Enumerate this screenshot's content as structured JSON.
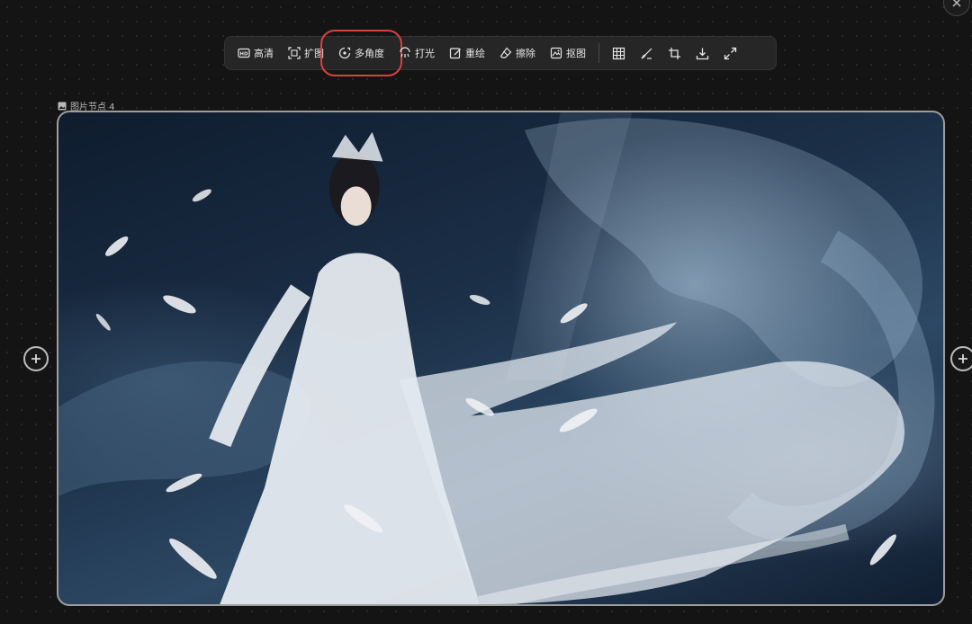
{
  "toolbar": {
    "buttons": [
      {
        "label": "高清",
        "icon": "hd-icon"
      },
      {
        "label": "扩图",
        "icon": "expand-image-icon"
      },
      {
        "label": "多角度",
        "icon": "multi-angle-icon",
        "highlighted": true
      },
      {
        "label": "打光",
        "icon": "lighting-icon"
      },
      {
        "label": "重绘",
        "icon": "redraw-icon"
      },
      {
        "label": "擦除",
        "icon": "eraser-icon"
      },
      {
        "label": "抠图",
        "icon": "cutout-icon"
      }
    ],
    "icon_buttons": [
      "grid-icon",
      "brush-icon",
      "crop-icon",
      "download-icon",
      "fullscreen-icon"
    ]
  },
  "node": {
    "label": "图片节点 4",
    "icon": "image-icon"
  },
  "colors": {
    "highlight": "#d9413e",
    "toolbar_bg": "#262626",
    "canvas_bg": "#141414",
    "frame_border": "#9d9d9d"
  }
}
